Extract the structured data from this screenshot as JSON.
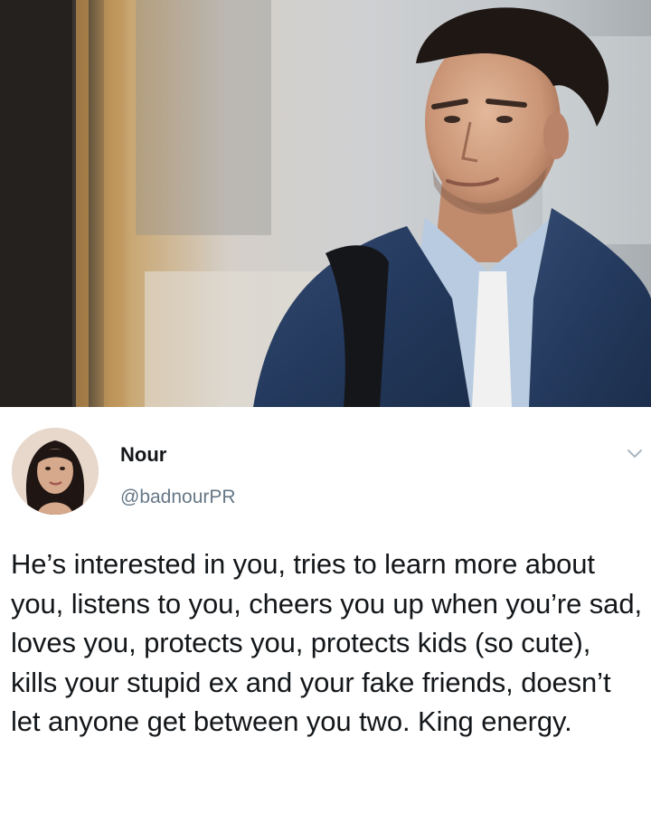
{
  "tweet": {
    "display_name": "Nour",
    "handle": "@badnourPR",
    "text": "He’s interested in you, tries to learn more about you, listens to you, cheers you up when you’re sad, loves you, protects you, protects kids (so cute), kills your stupid ex and your fake friends, doesn’t let anyone get between you two. King energy."
  },
  "icons": {
    "menu": "chevron-down-icon",
    "avatar": "user-avatar"
  },
  "colors": {
    "text_primary": "#14171a",
    "text_secondary": "#657786",
    "jacket_denim": "#2b3f63",
    "background": "#ffffff"
  }
}
